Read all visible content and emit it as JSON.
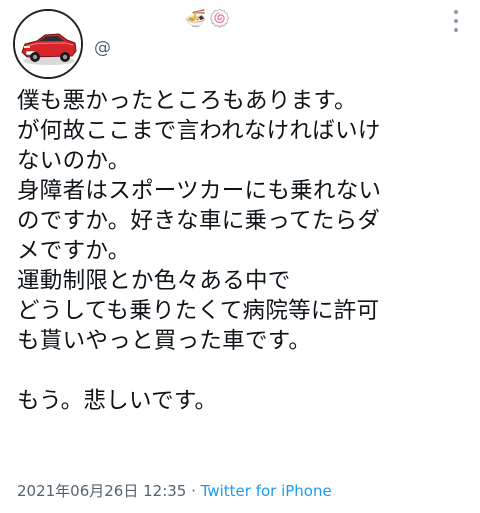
{
  "header": {
    "emoji_1": "🍜",
    "emoji_2": "🍥",
    "handle": "@"
  },
  "tweet": {
    "lines": [
      "僕も悪かったところもあります。",
      "が何故ここまで言われなければいけ",
      "ないのか。",
      "身障者はスポーツカーにも乗れない",
      "のですか。好きな車に乗ってたらダ",
      "メですか。",
      "運動制限とか色々ある中で",
      "どうしても乗りたくて病院等に許可",
      "も貰いやっと買った車です。",
      "",
      "もう。悲しいです。"
    ]
  },
  "meta": {
    "timestamp": "2021年06月26日 12:35",
    "separator": " · ",
    "source": "Twitter for iPhone"
  },
  "colors": {
    "text": "#0f1419",
    "secondary": "#536471",
    "link": "#1d9bf0",
    "car_red": "#d8252b"
  },
  "icons": {
    "avatar": "red-sports-car-avatar",
    "menu": "more-vertical-icon"
  }
}
